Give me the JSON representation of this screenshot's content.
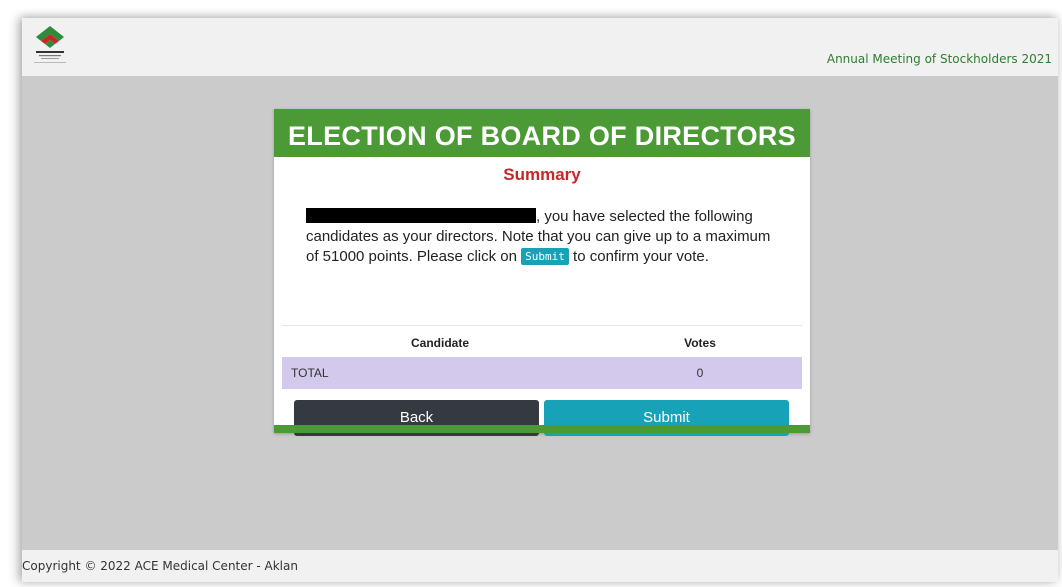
{
  "header": {
    "meeting_title": "Annual Meeting of Stockholders 2021",
    "logo_icon": "company-logo-icon"
  },
  "card": {
    "title": "ELECTION OF BOARD OF DIRECTORS",
    "subtitle": "Summary",
    "message_part1": ", you have selected the following candidates as your directors. Note that you can give up to a maximum of 51000 points. Please click on ",
    "message_code": "Submit",
    "message_part2": " to confirm your vote.",
    "table": {
      "columns": [
        "Candidate",
        "Votes"
      ],
      "total_label": "TOTAL",
      "total_votes": "0"
    },
    "back_label": "Back",
    "submit_label": "Submit"
  },
  "footer": {
    "copyright": "Copyright © 2022 ACE Medical Center - Aklan"
  },
  "colors": {
    "header_green": "#4b9a35",
    "summary_red": "#c62828",
    "submit_teal": "#17a2b8",
    "back_dark": "#343a40",
    "total_row_lavender": "#d2c9ec",
    "page_gray": "#cbcbcb"
  }
}
